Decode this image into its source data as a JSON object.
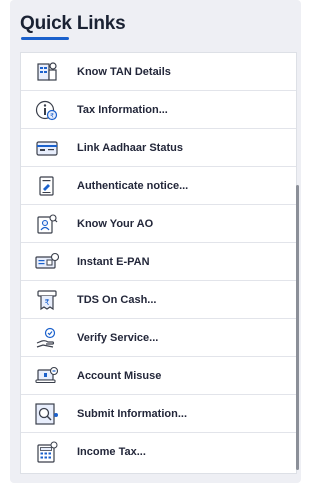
{
  "section": {
    "title": "Quick Links"
  },
  "links": [
    {
      "label": "Know TAN Details",
      "icon": "building-id-icon"
    },
    {
      "label": "Tax Information...",
      "icon": "info-rupee-icon"
    },
    {
      "label": "Link Aadhaar Status",
      "icon": "card-link-icon"
    },
    {
      "label": "Authenticate notice...",
      "icon": "notice-document-icon"
    },
    {
      "label": "Know Your AO",
      "icon": "officer-search-icon"
    },
    {
      "label": "Instant E-PAN",
      "icon": "pan-card-icon"
    },
    {
      "label": "TDS On Cash...",
      "icon": "receipt-cash-icon"
    },
    {
      "label": "Verify Service...",
      "icon": "hand-verify-icon"
    },
    {
      "label": "Account Misuse",
      "icon": "laptop-alert-icon"
    },
    {
      "label": "Submit Information...",
      "icon": "search-document-icon"
    },
    {
      "label": "Income Tax...",
      "icon": "calculator-icon"
    }
  ],
  "colors": {
    "accent": "#1b61cc",
    "icon_blue": "#1b61cc",
    "icon_dark": "#3a3f4b"
  }
}
